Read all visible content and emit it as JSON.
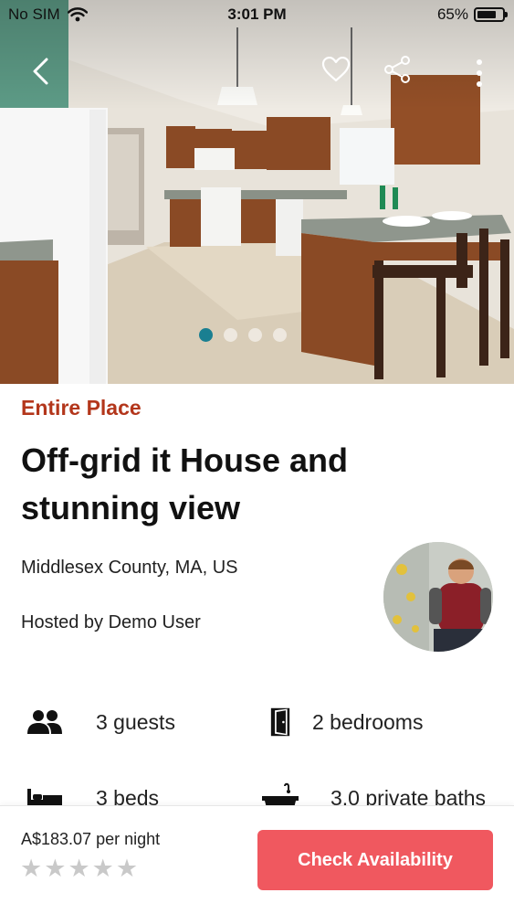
{
  "status_bar": {
    "carrier": "No SIM",
    "time": "3:01 PM",
    "battery": "65%",
    "icons": [
      "wifi-icon",
      "battery-icon"
    ]
  },
  "gallery": {
    "image": "kitchen-photo",
    "slide_count": 4,
    "active_slide": 1,
    "actions": [
      "back-icon",
      "heart-icon",
      "share-icon",
      "more-icon"
    ]
  },
  "listing": {
    "type": "Entire Place",
    "title": "Off-grid it House and stunning view",
    "location": "Middlesex County, MA, US",
    "host": "Hosted by Demo User"
  },
  "amenities": {
    "guests": "3 guests",
    "bedrooms": "2 bedrooms",
    "beds": "3 beds",
    "baths": "3.0 private baths",
    "icons": [
      "guests-icon",
      "door-icon",
      "bed-icon",
      "bathtub-icon"
    ]
  },
  "booking": {
    "price": "A$183.07 per night",
    "rating_stars": 5,
    "rating_filled": 0,
    "cta": "Check Availability"
  },
  "colors": {
    "accent": "#f0585f",
    "place_type": "#b3361b",
    "dot_active": "#1a7f91"
  }
}
